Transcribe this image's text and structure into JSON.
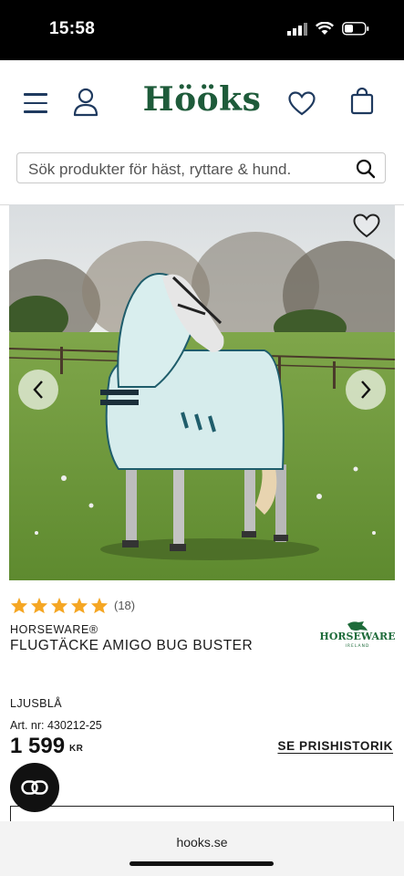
{
  "status": {
    "time": "15:58"
  },
  "header": {
    "logo": "Hööks",
    "search_placeholder": "Sök produkter för häst, ryttare & hund."
  },
  "product": {
    "rating_stars": 5,
    "review_count": "(18)",
    "brand": "HORSEWARE®",
    "name": "FLUGTÄCKE AMIGO BUG BUSTER",
    "brand_logo_text": "HORSEWARE",
    "brand_logo_sub": "IRELAND",
    "variant": "LJUSBLÅ",
    "article_number": "Art. nr: 430212-25",
    "price": "1 599",
    "currency": "KR",
    "price_history_link": "SE PRISHISTORIK"
  },
  "browser": {
    "url": "hooks.se"
  },
  "colors": {
    "brand_green": "#1e5b3a",
    "star": "#f5a623",
    "nav_blue": "#1f3a5f"
  }
}
